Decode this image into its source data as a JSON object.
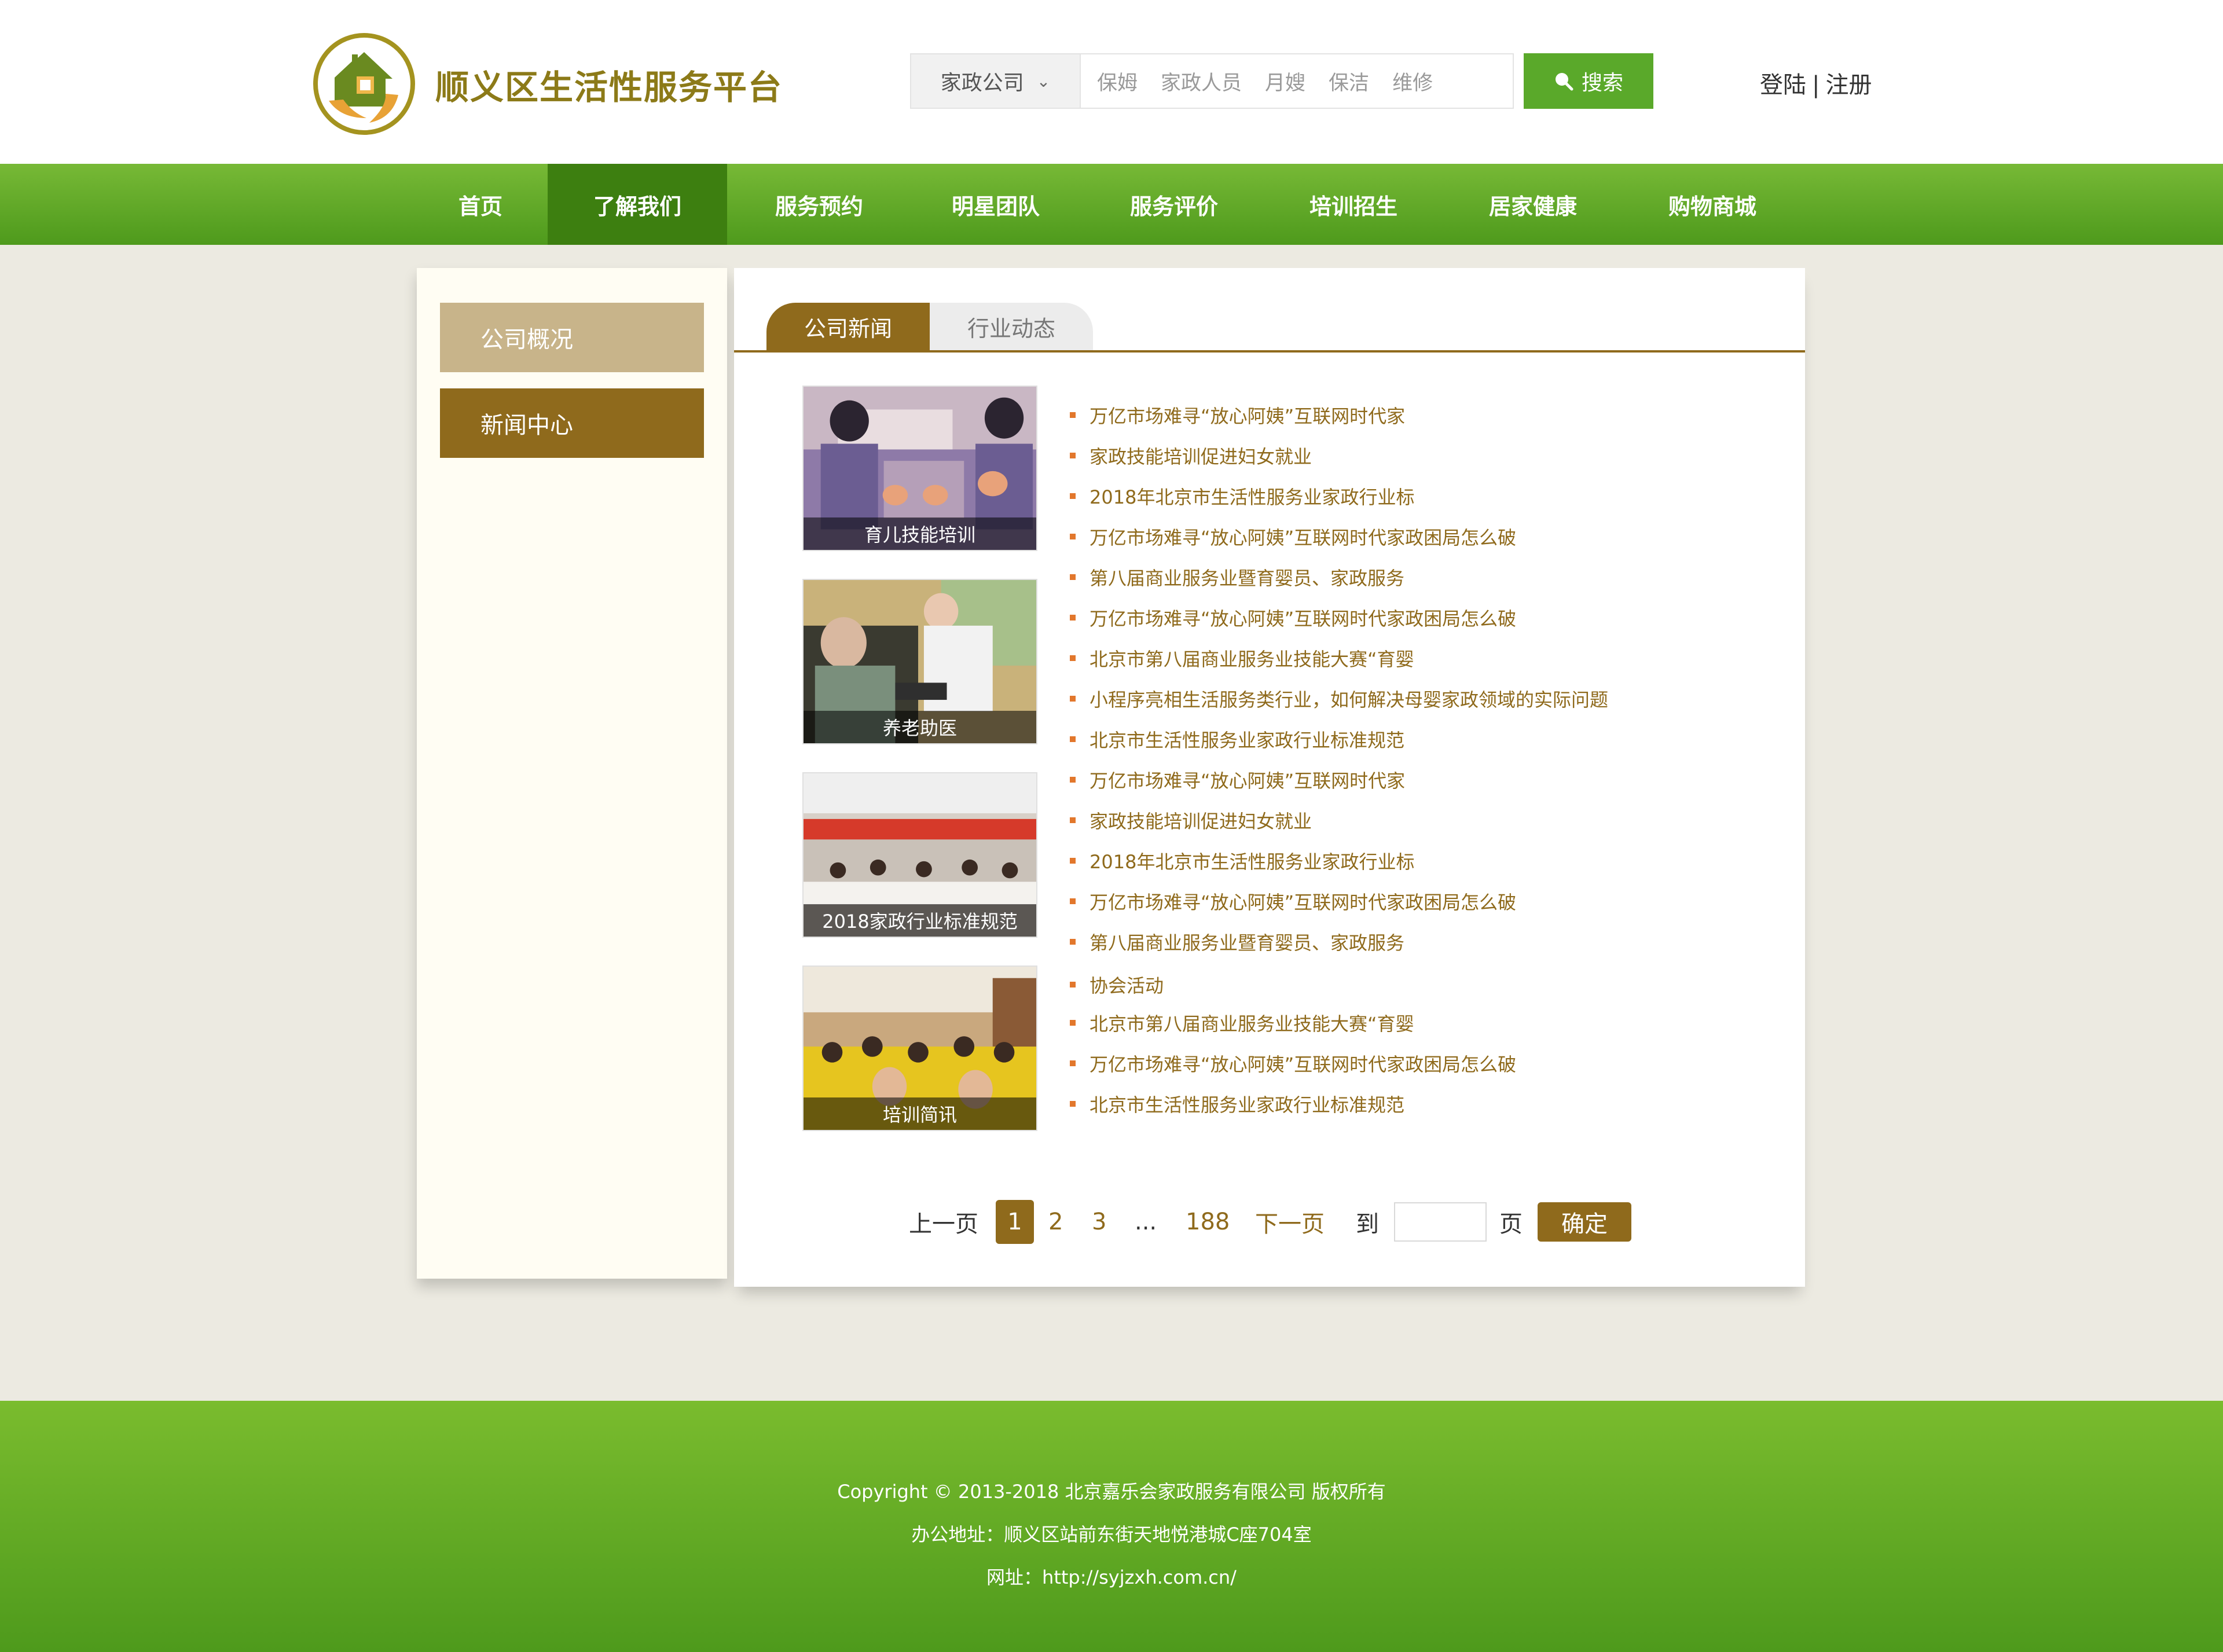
{
  "header": {
    "site_title": "顺义区生活性服务平台",
    "search": {
      "category": "家政公司",
      "hints": [
        "保姆",
        "家政人员",
        "月嫂",
        "保洁",
        "维修"
      ],
      "button_label": "搜索"
    },
    "auth": {
      "login": "登陆",
      "separator": "|",
      "register": "注册"
    }
  },
  "nav": {
    "items": [
      "首页",
      "了解我们",
      "服务预约",
      "明星团队",
      "服务评价",
      "培训招生",
      "居家健康",
      "购物商城"
    ],
    "active": "了解我们"
  },
  "sidebar": {
    "items": [
      "公司概况",
      "新闻中心"
    ],
    "active": "新闻中心"
  },
  "tabs": {
    "active": "公司新闻",
    "inactive": "行业动态"
  },
  "thumbnails": [
    "育儿技能培训",
    "养老助医",
    "2018家政行业标准规范",
    "培训简讯"
  ],
  "news": [
    "万亿市场难寻“放心阿姨”互联网时代家",
    "家政技能培训促进妇女就业",
    "2018年北京市生活性服务业家政行业标",
    "万亿市场难寻“放心阿姨”互联网时代家政困局怎么破",
    "第八届商业服务业暨育婴员、家政服务",
    "万亿市场难寻“放心阿姨”互联网时代家政困局怎么破",
    "北京市第八届商业服务业技能大赛“育婴",
    "小程序亮相生活服务类行业，如何解决母婴家政领域的实际问题",
    "北京市生活性服务业家政行业标准规范",
    "万亿市场难寻“放心阿姨”互联网时代家",
    "家政技能培训促进妇女就业",
    "2018年北京市生活性服务业家政行业标",
    "万亿市场难寻“放心阿姨”互联网时代家政困局怎么破",
    "第八届商业服务业暨育婴员、家政服务",
    "协会活动",
    "北京市第八届商业服务业技能大赛“育婴",
    "万亿市场难寻“放心阿姨”互联网时代家政困局怎么破",
    "北京市生活性服务业家政行业标准规范"
  ],
  "pagination": {
    "prev": "上一页",
    "pages": [
      "1",
      "2",
      "3"
    ],
    "ellipsis": "...",
    "last": "188",
    "next": "下一页",
    "goto_prefix": "到",
    "goto_suffix": "页",
    "confirm": "确定",
    "current": "1"
  },
  "footer": {
    "copyright": "Copyright © 2013-2018 北京嘉乐会家政服务有限公司 版权所有",
    "address": "办公地址：顺义区站前东街天地悦港城C座704室",
    "website": "网址：http://syjzxh.com.cn/"
  },
  "colors": {
    "brand_green": "#5aa92a",
    "nav_active": "#3d7f10",
    "brown": "#8f6a1c",
    "tan": "#c8b48a",
    "title_gold": "#8c7a18",
    "bullet": "#e2772c"
  }
}
